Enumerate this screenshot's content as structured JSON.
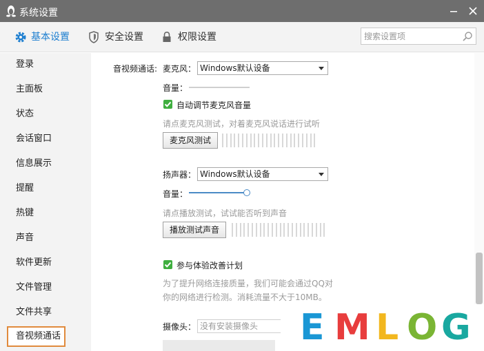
{
  "window": {
    "title": "系统设置"
  },
  "tabs": [
    {
      "label": "基本设置",
      "icon": "gear-icon"
    },
    {
      "label": "安全设置",
      "icon": "shield-icon"
    },
    {
      "label": "权限设置",
      "icon": "lock-icon"
    }
  ],
  "search": {
    "placeholder": "搜索设置项"
  },
  "sidebar": {
    "items": [
      {
        "label": "登录"
      },
      {
        "label": "主面板"
      },
      {
        "label": "状态"
      },
      {
        "label": "会话窗口"
      },
      {
        "label": "信息展示"
      },
      {
        "label": "提醒"
      },
      {
        "label": "热键"
      },
      {
        "label": "声音"
      },
      {
        "label": "软件更新"
      },
      {
        "label": "文件管理"
      },
      {
        "label": "文件共享"
      },
      {
        "label": "音视频通话"
      }
    ],
    "active_index": 11
  },
  "content": {
    "section_label": "音视频通话:",
    "microphone": {
      "label": "麦克风：",
      "device": "Windows默认设备",
      "volume_label": "音量：",
      "volume_level": 0,
      "auto_adjust_label": "自动调节麦克风音量",
      "auto_adjust_checked": true,
      "hint": "请点麦克风测试，对着麦克风说话进行试听",
      "test_button": "麦克风测试"
    },
    "speaker": {
      "label": "扬声器：",
      "device": "Windows默认设备",
      "volume_label": "音量：",
      "volume_level": 1.0,
      "hint": "请点播放测试，试试能否听到声音",
      "test_button": "播放测试声音"
    },
    "experience": {
      "label": "参与体验改善计划",
      "checked": true,
      "description_line1": "为了提升网络连接质量，我们可能会通过QQ对",
      "description_line2": "你的网络进行检测。消耗流量不大于10MB。"
    },
    "camera": {
      "label": "摄像头：",
      "value": "没有安装摄像头"
    }
  },
  "watermark": {
    "letters": [
      "E",
      "M",
      "L",
      "O",
      "G"
    ],
    "colors": [
      "#1a97d5",
      "#e83d3d",
      "#f2b71e",
      "#7ab534",
      "#19a8a0"
    ]
  },
  "colors": {
    "accent": "#1e7fd0",
    "titlebar": "#6e6e6e",
    "selection_border": "#e08a3c",
    "check": "#3fae3f"
  }
}
